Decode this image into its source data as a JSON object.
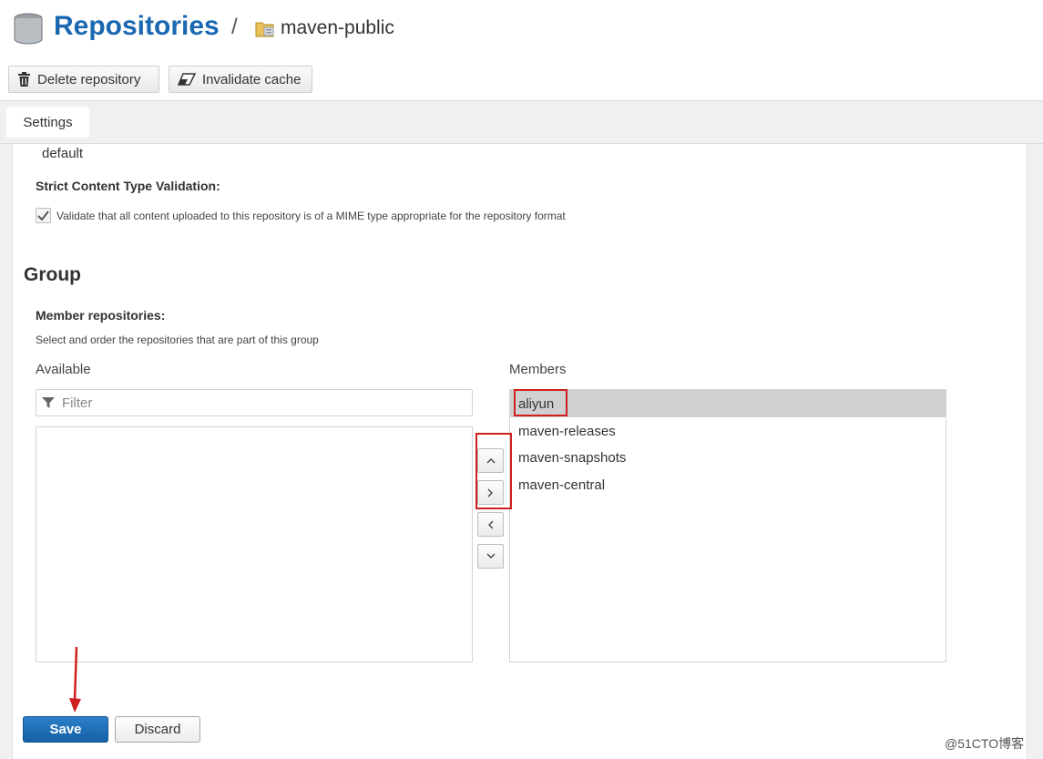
{
  "header": {
    "title": "Repositories",
    "separator": "/",
    "repo_name": "maven-public"
  },
  "toolbar": {
    "delete_label": "Delete repository",
    "invalidate_label": "Invalidate cache"
  },
  "tabs": [
    {
      "label": "Settings"
    }
  ],
  "form": {
    "default_value": "default",
    "strict_label": "Strict Content Type Validation:",
    "strict_checkbox_text": "Validate that all content uploaded to this repository is of a MIME type appropriate for the repository format",
    "strict_checked": true,
    "group_title": "Group",
    "member_label": "Member repositories:",
    "member_help": "Select and order the repositories that are part of this group",
    "available_label": "Available",
    "members_label": "Members",
    "filter_placeholder": "Filter",
    "members": [
      {
        "name": "aliyun",
        "selected": true
      },
      {
        "name": "maven-releases",
        "selected": false
      },
      {
        "name": "maven-snapshots",
        "selected": false
      },
      {
        "name": "maven-central",
        "selected": false
      }
    ]
  },
  "actions": {
    "save_label": "Save",
    "discard_label": "Discard"
  },
  "watermark": "@51CTO博客",
  "colors": {
    "title_blue": "#1a68b2",
    "save_blue": "#1661a6",
    "annotation_red": "#d01f1f"
  }
}
